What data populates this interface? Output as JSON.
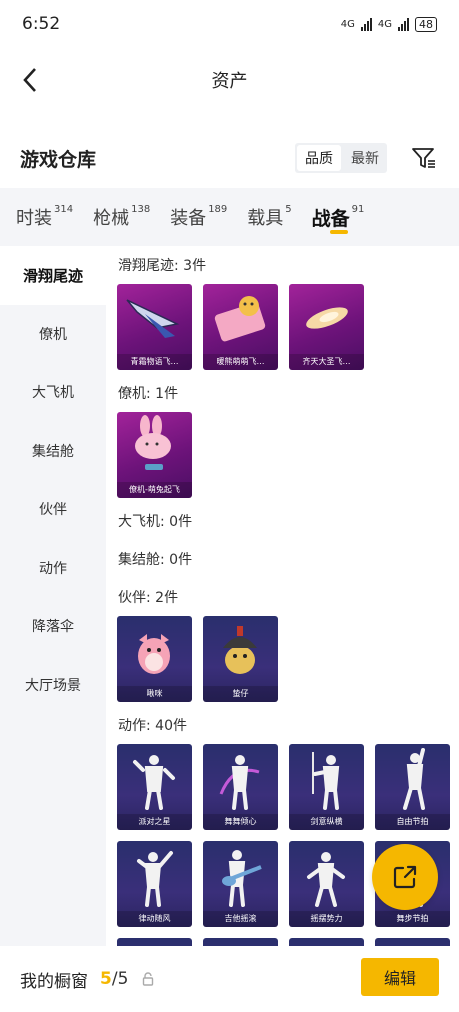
{
  "status": {
    "time": "6:52",
    "network1": "4G",
    "network2": "4G",
    "battery": "48"
  },
  "header": {
    "title": "资产"
  },
  "library": {
    "title": "游戏仓库",
    "sort_quality": "品质",
    "sort_latest": "最新"
  },
  "tabs": [
    {
      "label": "时装",
      "count": "314"
    },
    {
      "label": "枪械",
      "count": "138"
    },
    {
      "label": "装备",
      "count": "189"
    },
    {
      "label": "载具",
      "count": "5"
    },
    {
      "label": "战备",
      "count": "91"
    }
  ],
  "sidebar": [
    "滑翔尾迹",
    "僚机",
    "大飞机",
    "集结舱",
    "伙伴",
    "动作",
    "降落伞",
    "大厅场景"
  ],
  "groups": {
    "trail": {
      "title": "滑翔尾迹: 3件",
      "items": [
        "青霜物语飞…",
        "暖熊萌萌飞…",
        "齐天大圣飞…"
      ]
    },
    "wingman": {
      "title": "僚机: 1件",
      "items": [
        "僚机-萌兔起飞"
      ]
    },
    "plane": {
      "title": "大飞机: 0件"
    },
    "pod": {
      "title": "集结舱: 0件"
    },
    "partner": {
      "title": "伙伴: 2件",
      "items": [
        "啾咪",
        "蛰仔"
      ]
    },
    "emote": {
      "title": "动作: 40件",
      "items": [
        "派对之星",
        "舞舞倾心",
        "剑意纵横",
        "自由节拍",
        "律动随风",
        "吉他摇滚",
        "摇摆势力",
        "舞步节拍"
      ]
    }
  },
  "bottom": {
    "showcase_label": "我的橱窗",
    "current": "5",
    "separator": "/",
    "total": "5",
    "edit_label": "编辑"
  },
  "colors": {
    "accent": "#f5b700",
    "tab_bg": "#f4f5f8",
    "card_purple": "#8a1c8c",
    "card_blue": "#2e2f70"
  }
}
